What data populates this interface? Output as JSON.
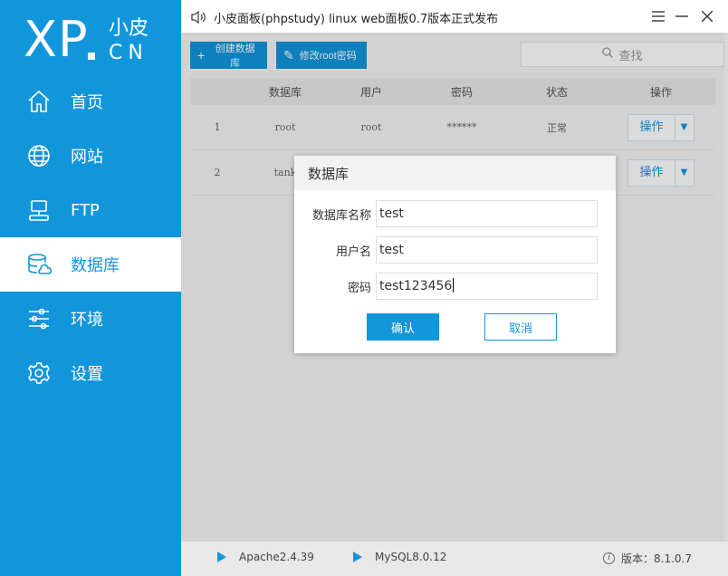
{
  "window": {
    "title": "小皮面板(phpstudy) linux web面板0.7版本正式发布"
  },
  "logo": {
    "brand": "XP",
    "cn": "小皮",
    "en": "CN"
  },
  "sidebar": {
    "items": [
      {
        "label": "首页",
        "icon": "home-icon"
      },
      {
        "label": "网站",
        "icon": "globe-icon"
      },
      {
        "label": "FTP",
        "icon": "server-icon"
      },
      {
        "label": "数据库",
        "icon": "database-icon",
        "active": true
      },
      {
        "label": "环境",
        "icon": "sliders-icon"
      },
      {
        "label": "设置",
        "icon": "gear-icon"
      }
    ]
  },
  "toolbar": {
    "create_label": "创建数据库",
    "modify_label": "修改root密码",
    "search_placeholder": "查找"
  },
  "table": {
    "headers": [
      "数据库",
      "用户",
      "密码",
      "状态",
      "操作"
    ],
    "rows": [
      {
        "index": "1",
        "db": "root",
        "user": "root",
        "pwd": "******",
        "status": "正常",
        "op": "操作"
      },
      {
        "index": "2",
        "db": "tank",
        "user": "",
        "pwd": "",
        "status": "",
        "op": "操作"
      }
    ]
  },
  "dialog": {
    "title": "数据库",
    "fields": [
      {
        "label": "数据库名称",
        "value": "test"
      },
      {
        "label": "用户名",
        "value": "test"
      },
      {
        "label": "密码",
        "value": "test123456"
      }
    ],
    "ok_label": "确认",
    "cancel_label": "取消"
  },
  "statusbar": {
    "apache": "Apache2.4.39",
    "mysql": "MySQL8.0.12",
    "version": "版本：8.1.0.7"
  },
  "colors": {
    "accent": "#1296db"
  }
}
